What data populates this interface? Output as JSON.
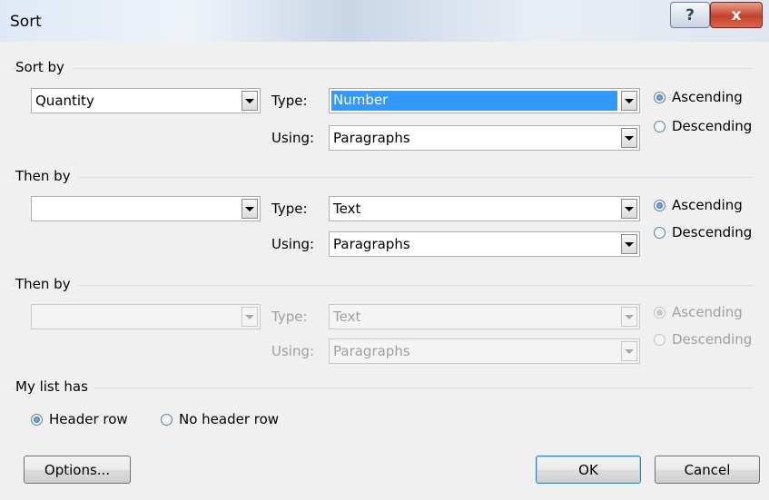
{
  "window": {
    "title": "Sort",
    "help_label": "?",
    "close_label": "x"
  },
  "sort_by": {
    "label": "Sort by",
    "field_value": "Quantity",
    "type_label": "Type:",
    "type_value": "Number",
    "using_label": "Using:",
    "using_value": "Paragraphs",
    "ascending_label": "Ascending",
    "descending_label": "Descending",
    "order_selected": "ascending"
  },
  "then_by_1": {
    "label": "Then by",
    "field_value": "",
    "type_label": "Type:",
    "type_value": "Text",
    "using_label": "Using:",
    "using_value": "Paragraphs",
    "ascending_label": "Ascending",
    "descending_label": "Descending",
    "order_selected": "ascending"
  },
  "then_by_2": {
    "label": "Then by",
    "field_value": "",
    "type_label": "Type:",
    "type_value": "Text",
    "using_label": "Using:",
    "using_value": "Paragraphs",
    "ascending_label": "Ascending",
    "descending_label": "Descending",
    "order_selected": "ascending",
    "enabled": false
  },
  "list_has": {
    "label": "My list has",
    "header_row_label": "Header row",
    "no_header_row_label": "No header row",
    "selected": "header_row"
  },
  "buttons": {
    "options": "Options...",
    "ok": "OK",
    "cancel": "Cancel"
  },
  "colors": {
    "selection": "#3399ff",
    "dialog_bg": "#f0f0f0",
    "disabled_text": "#a0a0a0",
    "close_button": "#c4412a"
  }
}
